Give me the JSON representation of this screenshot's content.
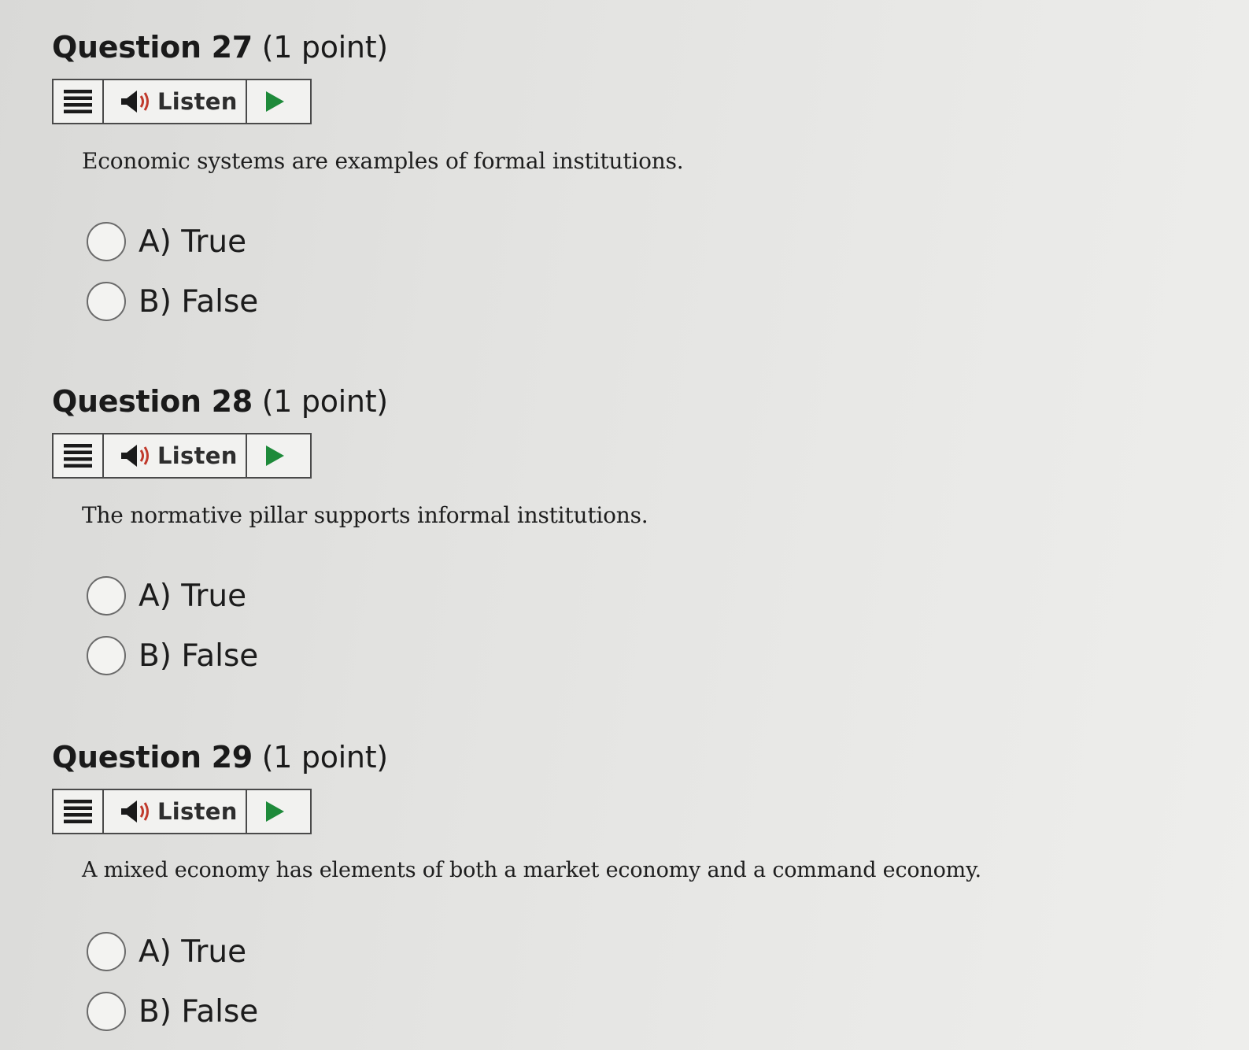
{
  "questions": [
    {
      "number_label": "Question 27",
      "points_label": "(1 point)",
      "listen_label": "Listen",
      "text": "Economic systems are examples of formal institutions.",
      "options": [
        {
          "label": "A) True"
        },
        {
          "label": "B) False"
        }
      ]
    },
    {
      "number_label": "Question 28",
      "points_label": "(1 point)",
      "listen_label": "Listen",
      "text": "The normative pillar supports informal institutions.",
      "options": [
        {
          "label": "A) True"
        },
        {
          "label": "B) False"
        }
      ]
    },
    {
      "number_label": "Question 29",
      "points_label": "(1 point)",
      "listen_label": "Listen",
      "text": "A mixed economy has elements of both a market economy and a command economy.",
      "options": [
        {
          "label": "A) True"
        },
        {
          "label": "B) False"
        }
      ]
    }
  ],
  "icons": {
    "menu": "menu-lines-icon",
    "speaker": "speaker-icon",
    "play": "play-icon"
  },
  "colors": {
    "play_green": "#1e8a3a",
    "speaker_red": "#c0392b",
    "border": "#4a4a4a"
  }
}
